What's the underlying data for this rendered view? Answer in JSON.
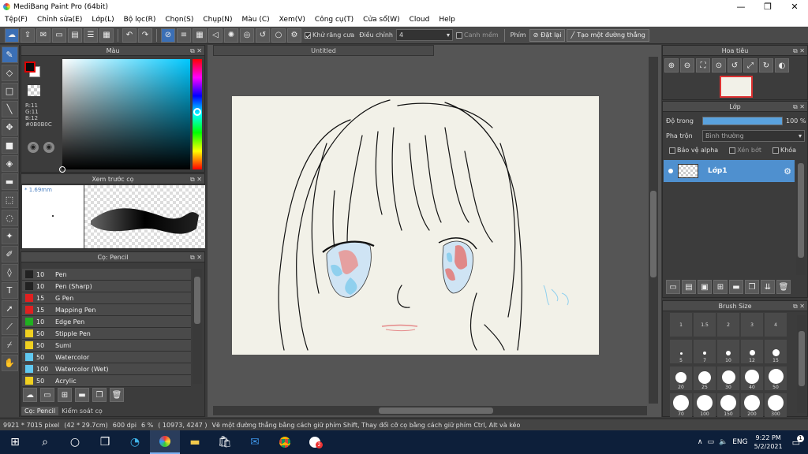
{
  "titlebar": {
    "title": "MediBang Paint Pro (64bit)"
  },
  "menu": [
    "Tệp(F)",
    "Chỉnh sửa(E)",
    "Lớp(L)",
    "Bộ lọc(R)",
    "Chọn(S)",
    "Chụp(N)",
    "Màu (C)",
    "Xem(V)",
    "Công cụ(T)",
    "Cửa sổ(W)",
    "Cloud",
    "Help"
  ],
  "toolbar": {
    "antialias_label": "Khử răng cưa",
    "correction_label": "Điều chỉnh",
    "correction_value": "4",
    "snap_label": "Canh mềm",
    "keys_label": "Phím",
    "reset_label": "Đặt lại",
    "line_label": "Tạo một đường thẳng"
  },
  "color_panel": {
    "title": "Màu",
    "r": "R:11",
    "g": "G:11",
    "b": "B:12",
    "hex": "#0B0B0C",
    "foreground": "#0b0b0c"
  },
  "preview_panel": {
    "title": "Xem trước cọ",
    "size": "* 1.69mm"
  },
  "brush_panel": {
    "title": "Cọ: Pencil",
    "items": [
      {
        "size": "10",
        "name": "Pen",
        "color": "#222222"
      },
      {
        "size": "10",
        "name": "Pen (Sharp)",
        "color": "#222222"
      },
      {
        "size": "15",
        "name": "G Pen",
        "color": "#e02020"
      },
      {
        "size": "15",
        "name": "Mapping Pen",
        "color": "#e02020"
      },
      {
        "size": "10",
        "name": "Edge Pen",
        "color": "#20b020"
      },
      {
        "size": "50",
        "name": "Stipple Pen",
        "color": "#f0d020"
      },
      {
        "size": "50",
        "name": "Sumi",
        "color": "#f0d020"
      },
      {
        "size": "50",
        "name": "Watercolor",
        "color": "#60c8f0"
      },
      {
        "size": "100",
        "name": "Watercolor (Wet)",
        "color": "#60c8f0"
      },
      {
        "size": "50",
        "name": "Acrylic",
        "color": "#f0d020"
      }
    ],
    "tab1": "Cọ: Pencil",
    "tab2": "Kiểm soát cọ"
  },
  "document": {
    "tab": "Untitled"
  },
  "navigator": {
    "title": "Hoa tiêu"
  },
  "layer_panel": {
    "title": "Lớp",
    "opacity_label": "Độ trong",
    "opacity_value": "100 %",
    "opacity_fraction": 1.0,
    "blend_label": "Pha trộn",
    "blend_value": "Bình thường",
    "alpha_label": "Bảo vệ alpha",
    "clip_label": "Xén bớt",
    "lock_label": "Khóa",
    "layer_name": "Lớp1"
  },
  "brush_size": {
    "title": "Brush Size",
    "top_labels": [
      "1",
      "1.5",
      "2",
      "3",
      "4"
    ],
    "sizes": [
      "5",
      "7",
      "10",
      "12",
      "15",
      "20",
      "25",
      "30",
      "40",
      "50",
      "70",
      "100",
      "150",
      "200",
      "300"
    ]
  },
  "status": {
    "dims": "9921 * 7015 pixel",
    "cm": "(42 * 29.7cm)",
    "dpi": "600 dpi",
    "zoom": "6 %",
    "coord": "( 10973, 4247 )",
    "hint": "Vẽ một đường thẳng bằng cách giữ phím Shift, Thay đổi cỡ cọ bằng cách giữ phím Ctrl, Alt và kéo"
  },
  "taskbar": {
    "lang": "ENG",
    "time": "9:22 PM",
    "date": "5/2/2021",
    "notif": "1",
    "badge": "2"
  }
}
